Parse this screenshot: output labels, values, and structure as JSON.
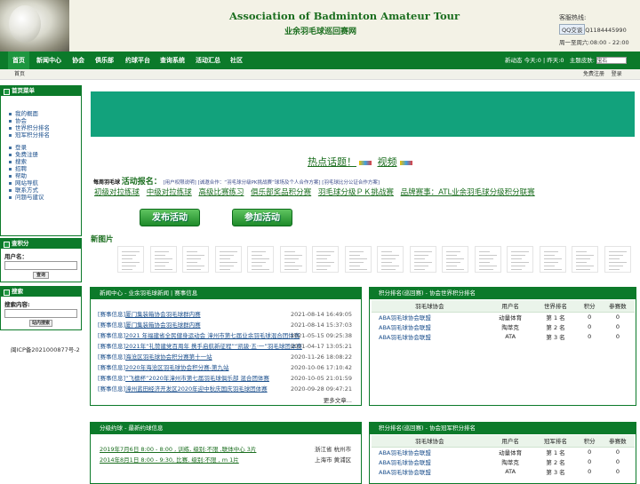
{
  "header": {
    "title_en": "Association of Badminton Amateur Tour",
    "title_cn": "业余羽毛球巡回赛网",
    "service_label": "客服热线:",
    "qq_label": "QQ交谈",
    "qq_number": "Q1184445990",
    "hours": "周一至周六:08:00 - 22:00"
  },
  "nav": {
    "items": [
      "首页",
      "新闻中心",
      "协会",
      "俱乐部",
      "约球平台",
      "查询系统",
      "活动汇总",
      "社区"
    ],
    "dynamic": "新动态 今天:0 | 昨天:0",
    "theme_label": "主题皮肤:",
    "theme_value": "宝石"
  },
  "subbar": {
    "home": "首页",
    "links": [
      "免费注册",
      "登录"
    ]
  },
  "sidebar": {
    "menu_title": "首页菜单",
    "menu_group1": [
      "我的概面",
      "协会",
      "世界积分排名",
      "冠军积分排名"
    ],
    "menu_group2": [
      "登录",
      "免费注册",
      "搜索",
      "招聘",
      "帮助",
      "网站导航",
      "联系方式",
      "问题与建议"
    ],
    "points_title": "查积分",
    "user_label": "用户名：",
    "query_button": "查询",
    "search_title": "搜索",
    "search_label": "搜索内容:",
    "search_button": "站内搜索",
    "icp": "闽ICP备2021000877号-2"
  },
  "hot": {
    "topic": "热点话题！",
    "video": "视频"
  },
  "activity": {
    "badge": "每周羽毛球",
    "title": "活动报名：",
    "links": [
      "[用户权限说明]",
      "[诚邀合作：“羽毛球分级PK挑战赛”球场及个人合作方案]",
      "[羽毛球比分公证合作方案]"
    ],
    "events": [
      "初级对拉练球",
      "中级对拉练球",
      "高级比赛练习",
      "俱乐部奖品积分赛",
      "羽毛球分级ＰＫ挑战赛",
      "品牌赛事：ATL业余羽毛球分级积分联赛"
    ],
    "publish_button": "发布活动",
    "join_button": "参加活动"
  },
  "new_pictures_label": "新图片",
  "news_panel": {
    "title": "新闻中心 - 业余羽毛球新闻 | 赛事信息",
    "rows": [
      {
        "cat": "[赛事信息]",
        "title": "厦门集装箱协会羽毛球群内赛",
        "date": "2021-08-14 16:49:05"
      },
      {
        "cat": "[赛事信息]",
        "title": "厦门集装箱协会羽毛球群内赛",
        "date": "2021-08-14 15:37:03"
      },
      {
        "cat": "[赛事信息]",
        "title": "2021 年福建省全民健身运动会 漳州市第七届业余羽毛球混合团体赛",
        "date": "2021-05-15 09:25:38"
      },
      {
        "cat": "[赛事信息]",
        "title": "2021年“礼赞建党百周年 携手启航新征程”“凯骏·五·一”羽毛球团体赛",
        "date": "2021-04-17 13:05:21"
      },
      {
        "cat": "[赛事信息]",
        "title": "海沧区羽毛球协会积分赛第十一站",
        "date": "2020-11-26 18:08:22"
      },
      {
        "cat": "[赛事信息]",
        "title": "2020年海沧区羽毛球协会积分赛-第九站",
        "date": "2020-10-06 17:10:42"
      },
      {
        "cat": "[赛事信息]",
        "title": "“飞檩杯”2020年漳州市第七届羽毛球俱乐部 混合团体赛",
        "date": "2020-10-05 21:01:59"
      },
      {
        "cat": "[赛事信息]",
        "title": "漳州蓝田经济开发区2020年迎中秋庆国庆羽毛球团体赛",
        "date": "2020-09-28 09:47:21"
      }
    ],
    "more": "更多文章..."
  },
  "world_rank": {
    "title": "积分排名(巡回赛) - 协会世界积分排名",
    "headers": [
      "羽毛球协会",
      "用户名",
      "世界排名",
      "积分",
      "参赛数"
    ],
    "rows": [
      {
        "org": "ABA羽毛球协会联盟",
        "user": "动量体育",
        "rank": "第 1 名",
        "points": "0",
        "games": "0"
      },
      {
        "org": "ABA羽毛球协会联盟",
        "user": "陶萃克",
        "rank": "第 2 名",
        "points": "0",
        "games": "0"
      },
      {
        "org": "ABA羽毛球协会联盟",
        "user": "ATA",
        "rank": "第 3 名",
        "points": "0",
        "games": "0"
      }
    ]
  },
  "yue_panel": {
    "title": "分级约球 - 最新约球信息",
    "rows": [
      {
        "title": "2019年7月6日 8:00 - 8:00 , 训练, 级别:不限 ,联体中心 3片",
        "city": "浙江省 杭州市"
      },
      {
        "title": "2014年8月1日 8:00 - 9:30, 比赛, 级别:不限 , m 1片",
        "city": "上海市 黄浦区"
      }
    ]
  },
  "champ_rank": {
    "title": "积分排名(巡回赛) - 协会冠军积分排名",
    "headers": [
      "羽毛球协会",
      "用户名",
      "冠军排名",
      "积分",
      "参赛数"
    ],
    "rows": [
      {
        "org": "ABA羽毛球协会联盟",
        "user": "动量体育",
        "rank": "第 1 名",
        "points": "0",
        "games": "0"
      },
      {
        "org": "ABA羽毛球协会联盟",
        "user": "陶萃克",
        "rank": "第 2 名",
        "points": "0",
        "games": "0"
      },
      {
        "org": "ABA羽毛球协会联盟",
        "user": "ATA",
        "rank": "第 3 名",
        "points": "0",
        "games": "0"
      }
    ]
  }
}
